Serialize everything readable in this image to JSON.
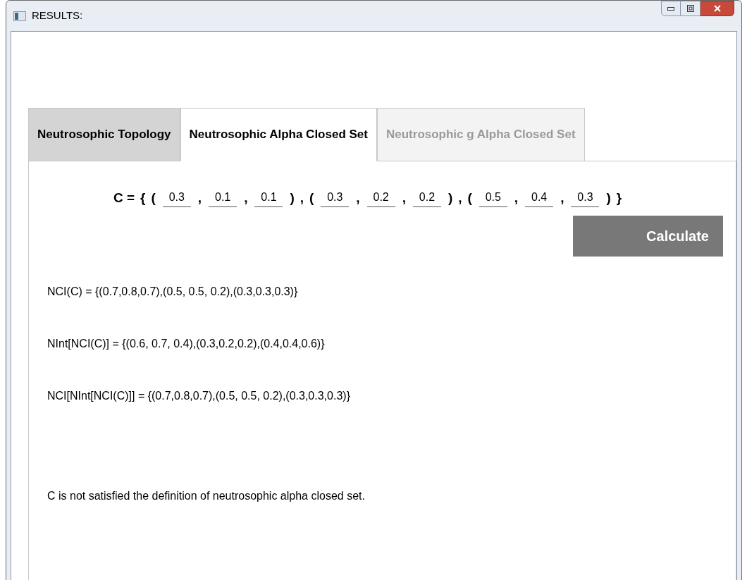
{
  "window": {
    "title": "RESULTS:"
  },
  "tabs": [
    {
      "label": "Neutrosophic Topology",
      "selected": false,
      "disabled": false
    },
    {
      "label": "Neutrosophic Alpha Closed Set",
      "selected": true,
      "disabled": false
    },
    {
      "label": "Neutrosophic g Alpha Closed Set",
      "selected": false,
      "disabled": true
    }
  ],
  "set_input": [
    {
      "kind": "text",
      "text": "C ="
    },
    {
      "kind": "text",
      "text": "{"
    },
    {
      "kind": "text",
      "text": "("
    },
    {
      "kind": "field",
      "value": "0.3"
    },
    {
      "kind": "text",
      "text": ","
    },
    {
      "kind": "field",
      "value": "0.1"
    },
    {
      "kind": "text",
      "text": ","
    },
    {
      "kind": "field",
      "value": "0.1"
    },
    {
      "kind": "text",
      "text": ")"
    },
    {
      "kind": "text",
      "text": ","
    },
    {
      "kind": "text",
      "text": "("
    },
    {
      "kind": "field",
      "value": "0.3"
    },
    {
      "kind": "text",
      "text": ","
    },
    {
      "kind": "field",
      "value": "0.2"
    },
    {
      "kind": "text",
      "text": ","
    },
    {
      "kind": "field",
      "value": "0.2"
    },
    {
      "kind": "text",
      "text": ")"
    },
    {
      "kind": "text",
      "text": ","
    },
    {
      "kind": "text",
      "text": "("
    },
    {
      "kind": "field",
      "value": "0.5"
    },
    {
      "kind": "text",
      "text": ","
    },
    {
      "kind": "field",
      "value": "0.4"
    },
    {
      "kind": "text",
      "text": ","
    },
    {
      "kind": "field",
      "value": "0.3"
    },
    {
      "kind": "text",
      "text": ")"
    },
    {
      "kind": "text",
      "text": "}"
    }
  ],
  "calculate_button": "Calculate",
  "results": [
    "NCI(C) = {(0.7,0.8,0.7),(0.5, 0.5, 0.2),(0.3,0.3,0.3)}",
    "NInt[NCI(C)] = {(0.6, 0.7, 0.4),(0.3,0.2,0.2),(0.4,0.4,0.6)}",
    "NCI[NInt[NCI(C)]] = {(0.7,0.8,0.7),(0.5, 0.5, 0.2),(0.3,0.3,0.3)}"
  ],
  "conclusion": "C is not satisfied the definition of neutrosophic alpha closed set."
}
